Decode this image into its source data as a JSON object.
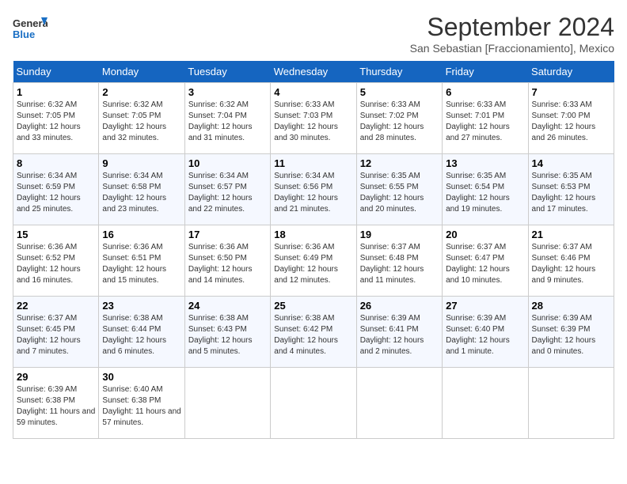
{
  "logo": {
    "text_general": "General",
    "text_blue": "Blue"
  },
  "title": "September 2024",
  "subtitle": "San Sebastian [Fraccionamiento], Mexico",
  "days_of_week": [
    "Sunday",
    "Monday",
    "Tuesday",
    "Wednesday",
    "Thursday",
    "Friday",
    "Saturday"
  ],
  "weeks": [
    [
      {
        "day": "1",
        "sunrise": "6:32 AM",
        "sunset": "7:05 PM",
        "daylight": "12 hours and 33 minutes."
      },
      {
        "day": "2",
        "sunrise": "6:32 AM",
        "sunset": "7:05 PM",
        "daylight": "12 hours and 32 minutes."
      },
      {
        "day": "3",
        "sunrise": "6:32 AM",
        "sunset": "7:04 PM",
        "daylight": "12 hours and 31 minutes."
      },
      {
        "day": "4",
        "sunrise": "6:33 AM",
        "sunset": "7:03 PM",
        "daylight": "12 hours and 30 minutes."
      },
      {
        "day": "5",
        "sunrise": "6:33 AM",
        "sunset": "7:02 PM",
        "daylight": "12 hours and 28 minutes."
      },
      {
        "day": "6",
        "sunrise": "6:33 AM",
        "sunset": "7:01 PM",
        "daylight": "12 hours and 27 minutes."
      },
      {
        "day": "7",
        "sunrise": "6:33 AM",
        "sunset": "7:00 PM",
        "daylight": "12 hours and 26 minutes."
      }
    ],
    [
      {
        "day": "8",
        "sunrise": "6:34 AM",
        "sunset": "6:59 PM",
        "daylight": "12 hours and 25 minutes."
      },
      {
        "day": "9",
        "sunrise": "6:34 AM",
        "sunset": "6:58 PM",
        "daylight": "12 hours and 23 minutes."
      },
      {
        "day": "10",
        "sunrise": "6:34 AM",
        "sunset": "6:57 PM",
        "daylight": "12 hours and 22 minutes."
      },
      {
        "day": "11",
        "sunrise": "6:34 AM",
        "sunset": "6:56 PM",
        "daylight": "12 hours and 21 minutes."
      },
      {
        "day": "12",
        "sunrise": "6:35 AM",
        "sunset": "6:55 PM",
        "daylight": "12 hours and 20 minutes."
      },
      {
        "day": "13",
        "sunrise": "6:35 AM",
        "sunset": "6:54 PM",
        "daylight": "12 hours and 19 minutes."
      },
      {
        "day": "14",
        "sunrise": "6:35 AM",
        "sunset": "6:53 PM",
        "daylight": "12 hours and 17 minutes."
      }
    ],
    [
      {
        "day": "15",
        "sunrise": "6:36 AM",
        "sunset": "6:52 PM",
        "daylight": "12 hours and 16 minutes."
      },
      {
        "day": "16",
        "sunrise": "6:36 AM",
        "sunset": "6:51 PM",
        "daylight": "12 hours and 15 minutes."
      },
      {
        "day": "17",
        "sunrise": "6:36 AM",
        "sunset": "6:50 PM",
        "daylight": "12 hours and 14 minutes."
      },
      {
        "day": "18",
        "sunrise": "6:36 AM",
        "sunset": "6:49 PM",
        "daylight": "12 hours and 12 minutes."
      },
      {
        "day": "19",
        "sunrise": "6:37 AM",
        "sunset": "6:48 PM",
        "daylight": "12 hours and 11 minutes."
      },
      {
        "day": "20",
        "sunrise": "6:37 AM",
        "sunset": "6:47 PM",
        "daylight": "12 hours and 10 minutes."
      },
      {
        "day": "21",
        "sunrise": "6:37 AM",
        "sunset": "6:46 PM",
        "daylight": "12 hours and 9 minutes."
      }
    ],
    [
      {
        "day": "22",
        "sunrise": "6:37 AM",
        "sunset": "6:45 PM",
        "daylight": "12 hours and 7 minutes."
      },
      {
        "day": "23",
        "sunrise": "6:38 AM",
        "sunset": "6:44 PM",
        "daylight": "12 hours and 6 minutes."
      },
      {
        "day": "24",
        "sunrise": "6:38 AM",
        "sunset": "6:43 PM",
        "daylight": "12 hours and 5 minutes."
      },
      {
        "day": "25",
        "sunrise": "6:38 AM",
        "sunset": "6:42 PM",
        "daylight": "12 hours and 4 minutes."
      },
      {
        "day": "26",
        "sunrise": "6:39 AM",
        "sunset": "6:41 PM",
        "daylight": "12 hours and 2 minutes."
      },
      {
        "day": "27",
        "sunrise": "6:39 AM",
        "sunset": "6:40 PM",
        "daylight": "12 hours and 1 minute."
      },
      {
        "day": "28",
        "sunrise": "6:39 AM",
        "sunset": "6:39 PM",
        "daylight": "12 hours and 0 minutes."
      }
    ],
    [
      {
        "day": "29",
        "sunrise": "6:39 AM",
        "sunset": "6:38 PM",
        "daylight": "11 hours and 59 minutes."
      },
      {
        "day": "30",
        "sunrise": "6:40 AM",
        "sunset": "6:38 PM",
        "daylight": "11 hours and 57 minutes."
      },
      null,
      null,
      null,
      null,
      null
    ]
  ]
}
